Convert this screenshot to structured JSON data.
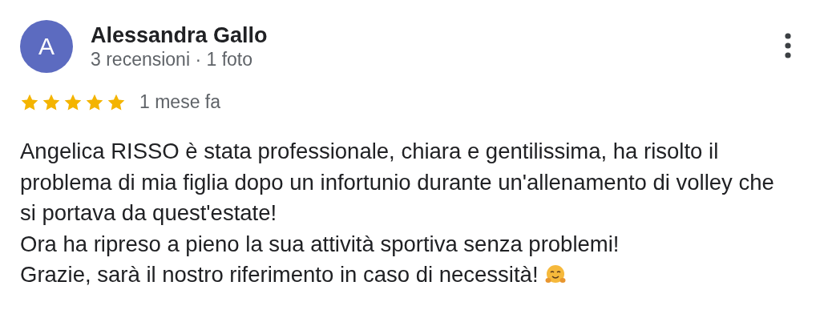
{
  "review": {
    "avatar_letter": "A",
    "author": "Alessandra Gallo",
    "meta": "3 recensioni · 1 foto",
    "stars": 5,
    "date": "1 mese fa",
    "lines": [
      "Angelica RISSO è stata professionale, chiara e gentilissima, ha risolto il",
      "problema di mia figlia dopo un infortunio durante un'allenamento di volley che",
      "si portava da quest'estate!",
      "Ora ha ripreso a pieno la sua attività sportiva senza problemi!",
      "Grazie, sarà il nostro riferimento in caso di necessità!"
    ]
  }
}
